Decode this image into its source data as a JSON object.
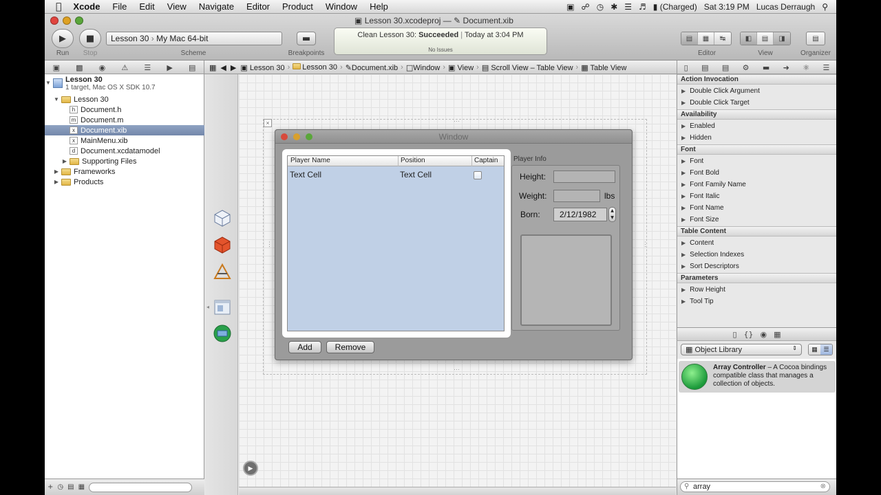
{
  "menubar": {
    "app_name": "Xcode",
    "items": [
      "File",
      "Edit",
      "View",
      "Navigate",
      "Editor",
      "Product",
      "Window",
      "Help"
    ],
    "battery": "(Charged)",
    "clock": "Sat 3:19 PM",
    "user": "Lucas Derraugh"
  },
  "window": {
    "title_project": "Lesson 30.xcodeproj",
    "title_sep": "—",
    "title_file": "Document.xib"
  },
  "toolbar": {
    "run_label": "Run",
    "stop_label": "Stop",
    "scheme_target": "Lesson 30",
    "scheme_dest": "My Mac 64-bit",
    "scheme_label": "Scheme",
    "breakpoints_label": "Breakpoints",
    "activity_prefix": "Clean Lesson 30:",
    "activity_status": "Succeeded",
    "activity_time": "Today at 3:04 PM",
    "activity_issues": "No Issues",
    "editor_label": "Editor",
    "view_label": "View",
    "organizer_label": "Organizer"
  },
  "jumpbar": [
    "Lesson 30",
    "Lesson 30",
    "Document.xib",
    "Window",
    "View",
    "Scroll View – Table View",
    "Table View"
  ],
  "navigator": {
    "project_name": "Lesson 30",
    "project_sub": "1 target, Mac OS X SDK 10.7",
    "group": "Lesson 30",
    "files": [
      "Document.h",
      "Document.m",
      "Document.xib",
      "MainMenu.xib",
      "Document.xcdatamodel"
    ],
    "file_icons": [
      "h",
      "m",
      "x",
      "x",
      "d"
    ],
    "subgroups": [
      "Supporting Files"
    ],
    "top_groups": [
      "Frameworks",
      "Products"
    ]
  },
  "canvas": {
    "window_title": "Window",
    "columns": [
      "Player Name",
      "Position",
      "Captain"
    ],
    "row": [
      "Text Cell",
      "Text Cell"
    ],
    "captain_checked": false,
    "add_label": "Add",
    "remove_label": "Remove",
    "box_title": "Player Info",
    "height_label": "Height:",
    "weight_label": "Weight:",
    "weight_unit": "lbs",
    "born_label": "Born:",
    "born_value": "2/12/1982"
  },
  "inspector": {
    "sections": [
      {
        "title": "Action Invocation",
        "items": [
          "Double Click Argument",
          "Double Click Target"
        ]
      },
      {
        "title": "Availability",
        "items": [
          "Enabled",
          "Hidden"
        ]
      },
      {
        "title": "Font",
        "items": [
          "Font",
          "Font Bold",
          "Font Family Name",
          "Font Italic",
          "Font Name",
          "Font Size"
        ]
      },
      {
        "title": "Table Content",
        "items": [
          "Content",
          "Selection Indexes",
          "Sort Descriptors"
        ]
      },
      {
        "title": "Parameters",
        "items": [
          "Row Height",
          "Tool Tip"
        ]
      }
    ]
  },
  "library": {
    "popup": "Object Library",
    "item_name": "Array Controller",
    "item_desc": " – A Cocoa bindings compatible class that manages a collection of objects.",
    "filter": "array"
  },
  "colors": {
    "close": "#e0443e",
    "minimize": "#dea123",
    "zoom": "#5aa63a",
    "selection": "#7d91b3",
    "table_bg": "#c0d0e6"
  }
}
